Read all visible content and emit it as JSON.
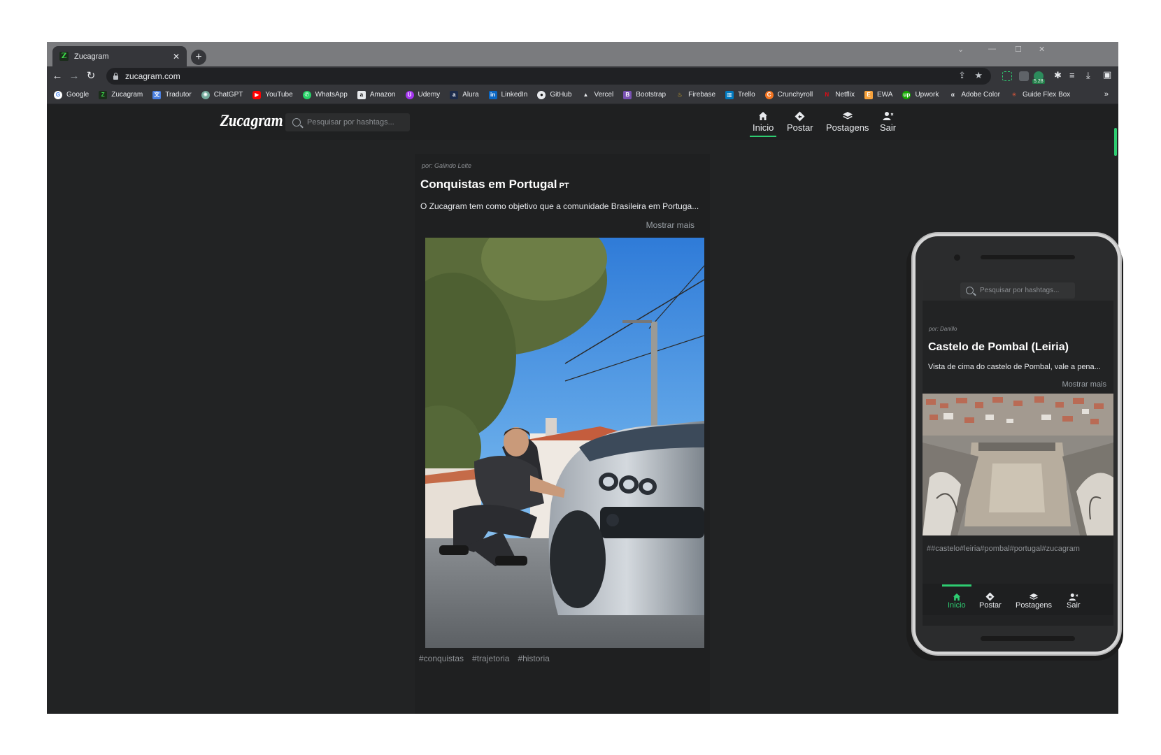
{
  "browser": {
    "tab_title": "Zucagram",
    "tab_favicon": "Z",
    "url": "zucagram.com",
    "extension_badge": "5.28",
    "bookmarks": [
      {
        "label": "Google",
        "icon": "google-icon",
        "color": "#4285f4"
      },
      {
        "label": "Zucagram",
        "icon": "zucagram-icon",
        "color": "#1b2d1b"
      },
      {
        "label": "Tradutor",
        "icon": "translate-icon",
        "color": "#4a7fe0"
      },
      {
        "label": "ChatGPT",
        "icon": "chatgpt-icon",
        "color": "#74aa9c"
      },
      {
        "label": "YouTube",
        "icon": "youtube-icon",
        "color": "#ff0000"
      },
      {
        "label": "WhatsApp",
        "icon": "whatsapp-icon",
        "color": "#25d366"
      },
      {
        "label": "Amazon",
        "icon": "amazon-icon",
        "color": "#e8eaed"
      },
      {
        "label": "Udemy",
        "icon": "udemy-icon",
        "color": "#a435f0"
      },
      {
        "label": "Alura",
        "icon": "alura-icon",
        "color": "#1c2b4b"
      },
      {
        "label": "LinkedIn",
        "icon": "linkedin-icon",
        "color": "#0a66c2"
      },
      {
        "label": "GitHub",
        "icon": "github-icon",
        "color": "#e8eaed"
      },
      {
        "label": "Vercel",
        "icon": "vercel-icon",
        "color": "#e8eaed"
      },
      {
        "label": "Bootstrap",
        "icon": "bootstrap-icon",
        "color": "#7952b3"
      },
      {
        "label": "Firebase",
        "icon": "firebase-icon",
        "color": "#ffca28"
      },
      {
        "label": "Trello",
        "icon": "trello-icon",
        "color": "#0079bf"
      },
      {
        "label": "Crunchyroll",
        "icon": "crunchyroll-icon",
        "color": "#f47521"
      },
      {
        "label": "Netflix",
        "icon": "netflix-icon",
        "color": "#e50914"
      },
      {
        "label": "EWA",
        "icon": "ewa-icon",
        "color": "#f7a23b"
      },
      {
        "label": "Upwork",
        "icon": "upwork-icon",
        "color": "#14a800"
      },
      {
        "label": "Adobe Color",
        "icon": "adobe-color-icon",
        "color": "#e8eaed"
      },
      {
        "label": "Guide Flex Box",
        "icon": "flexbox-guide-icon",
        "color": "#f25c3a"
      }
    ],
    "bookmarks_overflow": "»"
  },
  "app": {
    "logo": "Zucagram",
    "search_placeholder": "Pesquisar por hashtags...",
    "accent_color": "#2ecc71",
    "nav": [
      {
        "label": "Inicio",
        "icon": "home-icon",
        "active": true
      },
      {
        "label": "Postar",
        "icon": "post-diamond-icon",
        "active": false
      },
      {
        "label": "Postagens",
        "icon": "layers-icon",
        "active": false
      },
      {
        "label": "Sair",
        "icon": "logout-user-icon",
        "active": false
      }
    ]
  },
  "post": {
    "author": "por: Galindo Leite",
    "title": "Conquistas em Portugal",
    "title_flag": "PT",
    "description": "O Zucagram tem como objetivo que a comunidade Brasileira em Portuga...",
    "more": "Mostrar mais",
    "tags": [
      "#conquistas",
      "#trajetoria",
      "#historia"
    ]
  },
  "phone": {
    "search_placeholder": "Pesquisar por hashtags...",
    "post": {
      "author": "por: Danillo",
      "title": "Castelo de Pombal (Leiria)",
      "description": "Vista de cima do castelo de Pombal, vale a pena...",
      "more": "Mostrar mais",
      "tags": "##castelo#leiria#pombal#portugal#zucagram"
    },
    "nav": [
      {
        "label": "Inicio",
        "icon": "home-icon",
        "active": true
      },
      {
        "label": "Postar",
        "icon": "post-diamond-icon",
        "active": false
      },
      {
        "label": "Postagens",
        "icon": "layers-icon",
        "active": false
      },
      {
        "label": "Sair",
        "icon": "logout-user-icon",
        "active": false
      }
    ]
  }
}
